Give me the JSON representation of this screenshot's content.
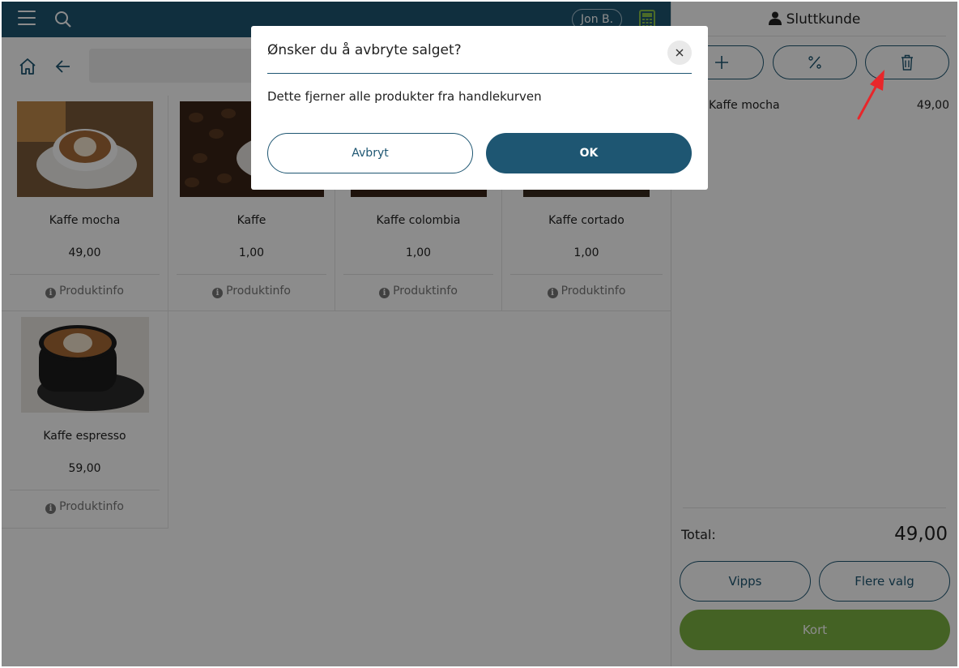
{
  "topbar": {
    "user": "Jon B.",
    "menu_icon": "hamburger-icon",
    "search_icon": "search-icon",
    "calc_icon": "calculator-icon",
    "bg": "#1e5672"
  },
  "subbar": {
    "home_icon": "home-icon",
    "back_icon": "arrow-left-icon"
  },
  "products": [
    {
      "name": "Kaffe mocha",
      "price": "49,00",
      "info": "Produktinfo"
    },
    {
      "name": "Kaffe",
      "price": "1,00",
      "info": "Produktinfo"
    },
    {
      "name": "Kaffe colombia",
      "price": "1,00",
      "info": "Produktinfo"
    },
    {
      "name": "Kaffe cortado",
      "price": "1,00",
      "info": "Produktinfo"
    },
    {
      "name": "Kaffe espresso",
      "price": "59,00",
      "info": "Produktinfo"
    }
  ],
  "cart": {
    "customer": "Sluttkunde",
    "actions": [
      "plus-icon",
      "percent-icon",
      "trash-icon"
    ],
    "items": [
      {
        "name": "Kaffe mocha",
        "price": "49,00"
      }
    ],
    "total_label": "Total:",
    "total_value": "49,00",
    "buttons": {
      "vipps": "Vipps",
      "more": "Flere valg",
      "card": "Kort"
    }
  },
  "modal": {
    "title": "Ønsker du å avbryte salget?",
    "text": "Dette fjerner alle produkter fra handlekurven",
    "cancel": "Avbryt",
    "ok": "OK"
  },
  "colors": {
    "primary": "#1e5672",
    "accent_green": "#7db342",
    "annotation": "#e8262a"
  }
}
